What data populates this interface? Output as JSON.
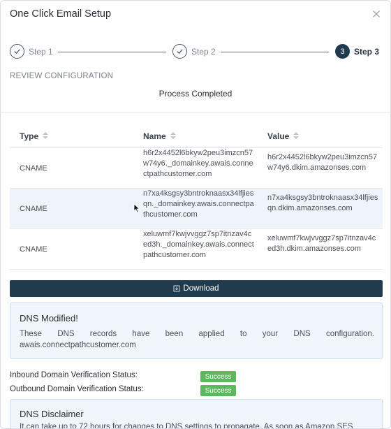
{
  "dialog": {
    "title": "One Click Email Setup",
    "close_icon": "close-icon"
  },
  "stepper": {
    "steps": [
      {
        "label": "Step 1",
        "state": "completed"
      },
      {
        "label": "Step 2",
        "state": "completed"
      },
      {
        "label": "Step 3",
        "state": "active",
        "number": "3"
      }
    ]
  },
  "review": {
    "heading": "REVIEW CONFIGURATION",
    "status": "Process Completed"
  },
  "table": {
    "columns": [
      "Type",
      "Name",
      "Value"
    ],
    "rows": [
      {
        "type": "CNAME",
        "name": "h6r2x4452l6bkyw2peu3imzcn57w74y6._domainkey.awais.connectpathcustomer.com",
        "value": "h6r2x4452l6bkyw2peu3imzcn57w74y6.dkim.amazonses.com"
      },
      {
        "type": "CNAME",
        "name": "n7xa4ksgsy3bntroknaasx34lfjiesqn._domainkey.awais.connectpathcustomer.com",
        "value": "n7xa4ksgsy3bntroknaasx34lfjiesqn.dkim.amazonses.com"
      },
      {
        "type": "CNAME",
        "name": "xeluwmf7kwjvvggz7sp7itnzav4ced3h._domainkey.awais.connectpathcustomer.com",
        "value": "xeluwmf7kwjvvggz7sp7itnzav4ced3h.dkim.amazonses.com"
      }
    ]
  },
  "download": {
    "label": "Download",
    "icon": "download-icon"
  },
  "dns_modified": {
    "title": "DNS Modified!",
    "body_line1": "These DNS records have been applied to your DNS configuration.",
    "body_line2": "awais.connectpathcustomer.com"
  },
  "verification": {
    "inbound_label": "Inbound Domain Verification Status:",
    "inbound_status": "Success",
    "outbound_label": "Outbound Domain Verification Status:",
    "outbound_status": "Success",
    "success_color": "#5cb85c"
  },
  "disclaimer": {
    "title": "DNS Disclaimer",
    "body": "It can take up to 72 hours for changes to DNS settings to propagate. As soon as Amazon SES"
  },
  "colors": {
    "primary": "#1f3b4d",
    "alert_bg": "#f0f6fc",
    "row_highlight": "#eef4fa"
  }
}
